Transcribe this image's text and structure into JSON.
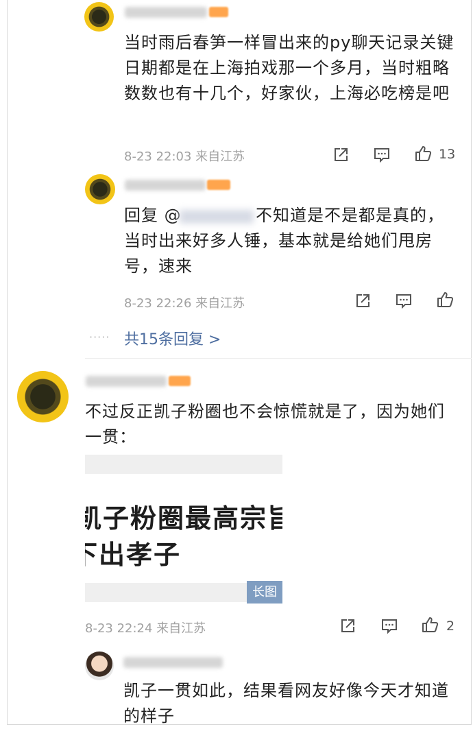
{
  "comments": {
    "c1": {
      "text": "当时雨后春笋一样冒出来的py聊天记录关键日期都是在上海拍戏那一个多月，当时粗略数数也有十几个，好家伙，上海必吃榜是吧",
      "meta": "8-23 22:03 来自江苏",
      "like_count": "13",
      "reply": {
        "text_prefix": "回复 @",
        "text": "不知道是不是都是真的，当时出来好多人锤，基本就是给她们甩房号，速来",
        "meta": "8-23 22:26 来自江苏",
        "more_replies": "共15条回复 >"
      }
    },
    "c2": {
      "text": "不过反正凯子粉圈也不会惊慌就是了，因为她们一贯：",
      "image": {
        "line1": "凯子粉圈最高宗旨",
        "line2": "下出孝子",
        "badge": "长图"
      },
      "meta": "8-23 22:24 来自江苏",
      "like_count": "2",
      "reply": {
        "text": "凯子一贯如此，结果看网友好像今天才知道的样子"
      }
    }
  },
  "ui": {
    "dots": "·····",
    "icons": [
      "share-icon",
      "comment-icon",
      "like-icon"
    ],
    "accent": "#4e6ea0",
    "badge_color": "#7f9dc1"
  }
}
